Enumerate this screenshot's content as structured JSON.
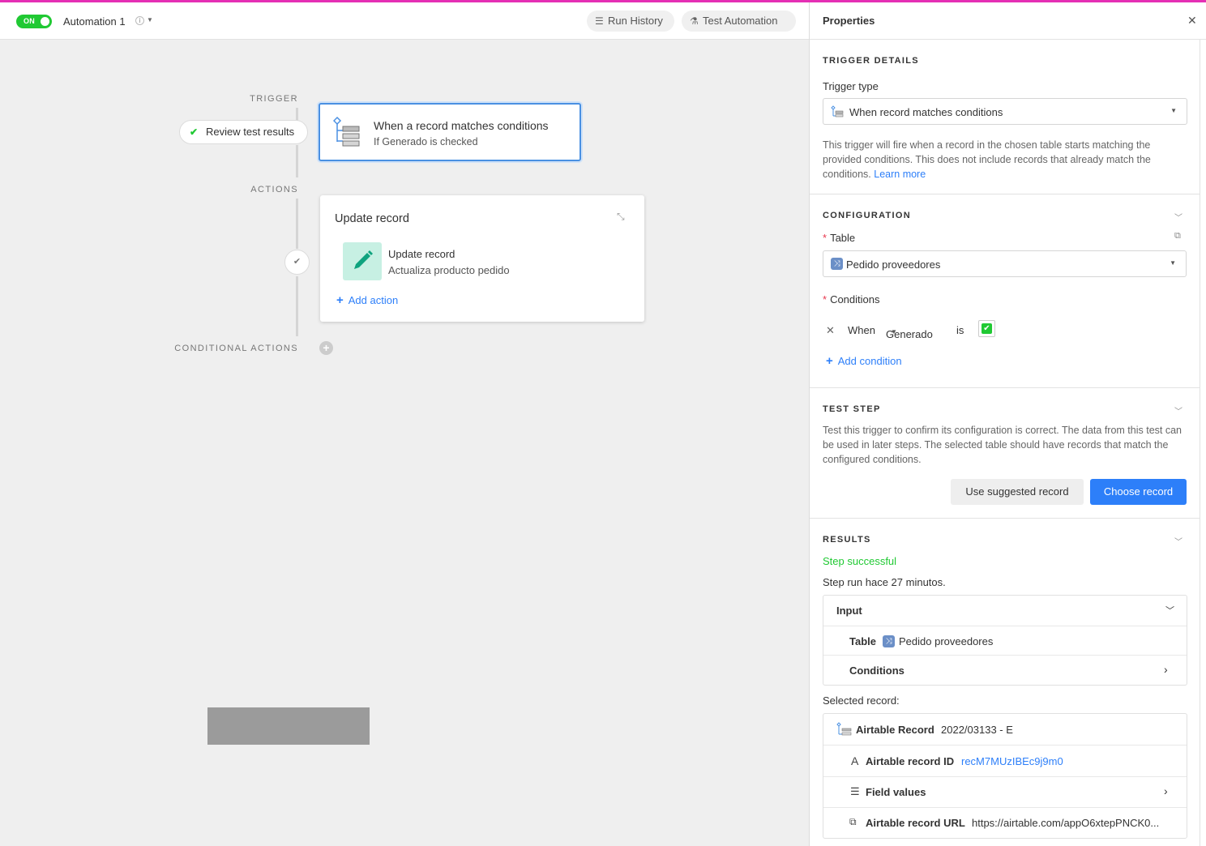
{
  "header": {
    "toggle_label": "ON",
    "automation_name": "Automation 1",
    "run_history_label": "Run History",
    "test_automation_label": "Test Automation",
    "accent_color": "#20c933"
  },
  "canvas": {
    "trigger_label": "TRIGGER",
    "actions_label": "ACTIONS",
    "conditional_actions_label": "CONDITIONAL ACTIONS",
    "review_label": "Review test results",
    "trigger_card": {
      "title": "When a record matches conditions",
      "subtitle": "If Generado is checked"
    },
    "action_card": {
      "title": "Update record",
      "step_title": "Update record",
      "step_subtitle": "Actualiza producto pedido",
      "add_action_label": "Add action"
    }
  },
  "panel": {
    "title": "Properties",
    "trigger_details": {
      "heading": "TRIGGER DETAILS",
      "trigger_type_label": "Trigger type",
      "trigger_type_value": "When record matches conditions",
      "description": "This trigger will fire when a record in the chosen table starts matching the provided conditions. This does not include records that already match the conditions.",
      "learn_more": "Learn more"
    },
    "configuration": {
      "heading": "CONFIGURATION",
      "table_label": "Table",
      "table_value": "Pedido proveedores",
      "conditions_label": "Conditions",
      "condition": {
        "when": "When",
        "field": "Generado",
        "operator": "is"
      },
      "add_condition_label": "Add condition"
    },
    "test_step": {
      "heading": "TEST STEP",
      "description": "Test this trigger to confirm its configuration is correct. The data from this test can be used in later steps. The selected table should have records that match the configured conditions.",
      "use_suggested_label": "Use suggested record",
      "choose_record_label": "Choose record"
    },
    "results": {
      "heading": "RESULTS",
      "status": "Step successful",
      "run_time": "Step run hace 27 minutos.",
      "input": {
        "label": "Input",
        "table_key": "Table",
        "table_value": "Pedido proveedores",
        "conditions_label": "Conditions"
      },
      "selected_record_label": "Selected record:",
      "record": {
        "type_label": "Airtable Record",
        "name_value": "2022/03133 - E",
        "id_label": "Airtable record ID",
        "id_value": "recM7MUzIBEc9j9m0",
        "field_values_label": "Field values",
        "url_label": "Airtable record URL",
        "url_value": "https://airtable.com/appO6xtepPNCK0..."
      }
    }
  }
}
